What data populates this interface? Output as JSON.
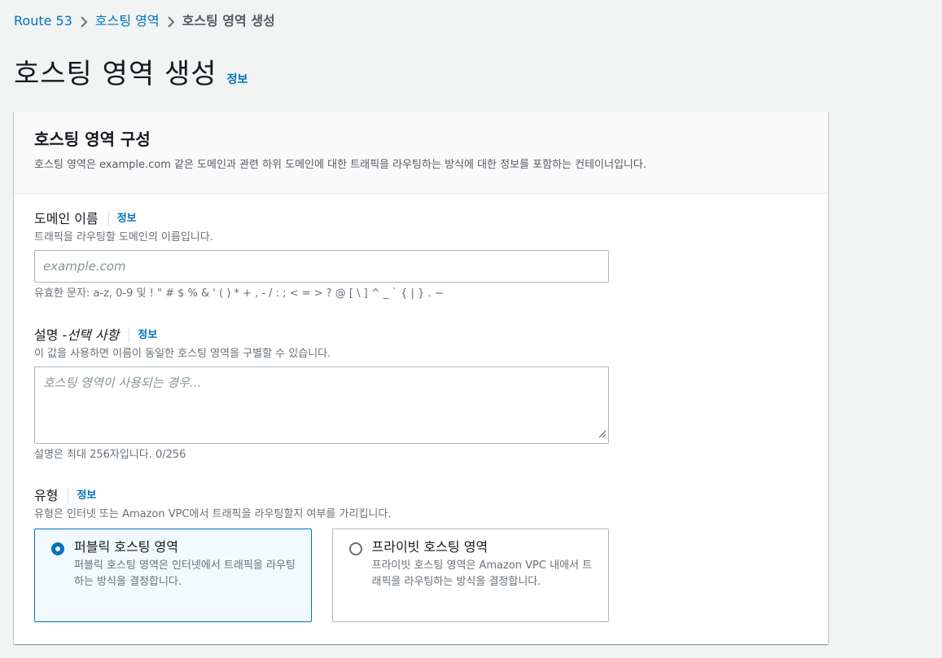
{
  "breadcrumb": {
    "items": [
      "Route 53",
      "호스팅 영역"
    ],
    "current": "호스팅 영역 생성"
  },
  "page": {
    "title": "호스팅 영역 생성",
    "info": "정보"
  },
  "panel": {
    "title": "호스팅 영역 구성",
    "description": "호스팅 영역은 example.com 같은 도메인과 관련 하위 도메인에 대한 트래픽을 라우팅하는 방식에 대한 정보를 포함하는 컨테이너입니다."
  },
  "domain_field": {
    "label": "도메인 이름",
    "info": "정보",
    "description": "트래픽을 라우팅할 도메인의 이름입니다.",
    "placeholder": "example.com",
    "value": "",
    "constraint": "유효한 문자: a-z, 0-9 및 ! \" # $ % & ' ( ) * + , - / : ; < = > ? @ [ \\ ] ^ _ ` { | } . ~"
  },
  "description_field": {
    "label": "설명 - ",
    "label_optional": "선택 사항",
    "info": "정보",
    "description": "이 값을 사용하면 이름이 동일한 호스팅 영역을 구별할 수 있습니다.",
    "placeholder": "호스팅 영역이 사용되는 경우...",
    "constraint": "설명은 최대 256자입니다. 0/256"
  },
  "type_field": {
    "label": "유형",
    "info": "정보",
    "description": "유형은 인터넷 또는 Amazon VPC에서 트래픽을 라우팅할지 여부를 가리킵니다.",
    "options": [
      {
        "title": "퍼블릭 호스팅 영역",
        "description": "퍼블릭 호스팅 영역은 인터넷에서 트래픽을 라우팅하는 방식을 결정합니다.",
        "selected": true
      },
      {
        "title": "프라이빗 호스팅 영역",
        "description": "프라이빗 호스팅 영역은 Amazon VPC 내에서 트래픽을 라우팅하는 방식을 결정합니다.",
        "selected": false
      }
    ]
  },
  "colors": {
    "link": "#0073bb",
    "background": "#f2f3f3",
    "selected_tile_bg": "#f1faff"
  }
}
